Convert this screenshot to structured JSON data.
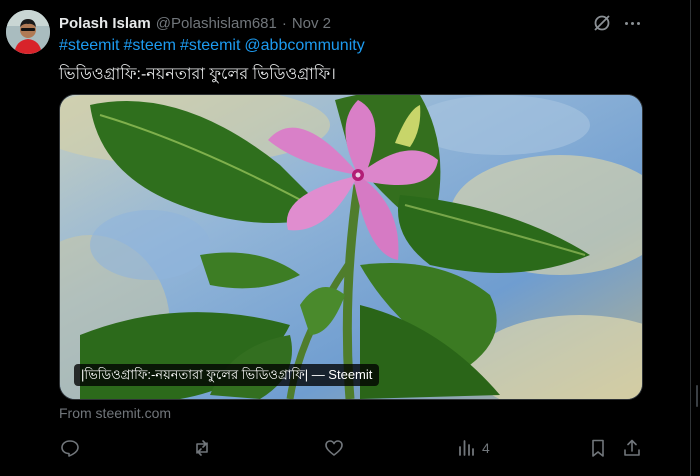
{
  "post": {
    "author_name": "Polash Islam",
    "author_handle": "@Polashislam681",
    "separator": "·",
    "date": "Nov 2",
    "hashtags": [
      "#steemit",
      "#steem",
      "#steemit",
      "@abbcommunity"
    ],
    "text": "ভিডিওগ্রাফি:-নয়নতারা ফুলের ভিডিওগ্রাফি।"
  },
  "media": {
    "caption": "|ভিডিওগ্রাফি:-নয়নতারা ফুলের ভিডিওগ্রাফি| — Steemit",
    "source": "From steemit.com"
  },
  "actions": {
    "views_count": "4"
  },
  "icons": [
    "avatar",
    "grok-icon",
    "more-icon",
    "reply-icon",
    "repost-icon",
    "like-icon",
    "views-icon",
    "bookmark-icon",
    "share-icon"
  ],
  "colors": {
    "accent": "#1d9bf0",
    "muted": "#71767b",
    "text": "#e7e9ea",
    "background": "#000000"
  }
}
